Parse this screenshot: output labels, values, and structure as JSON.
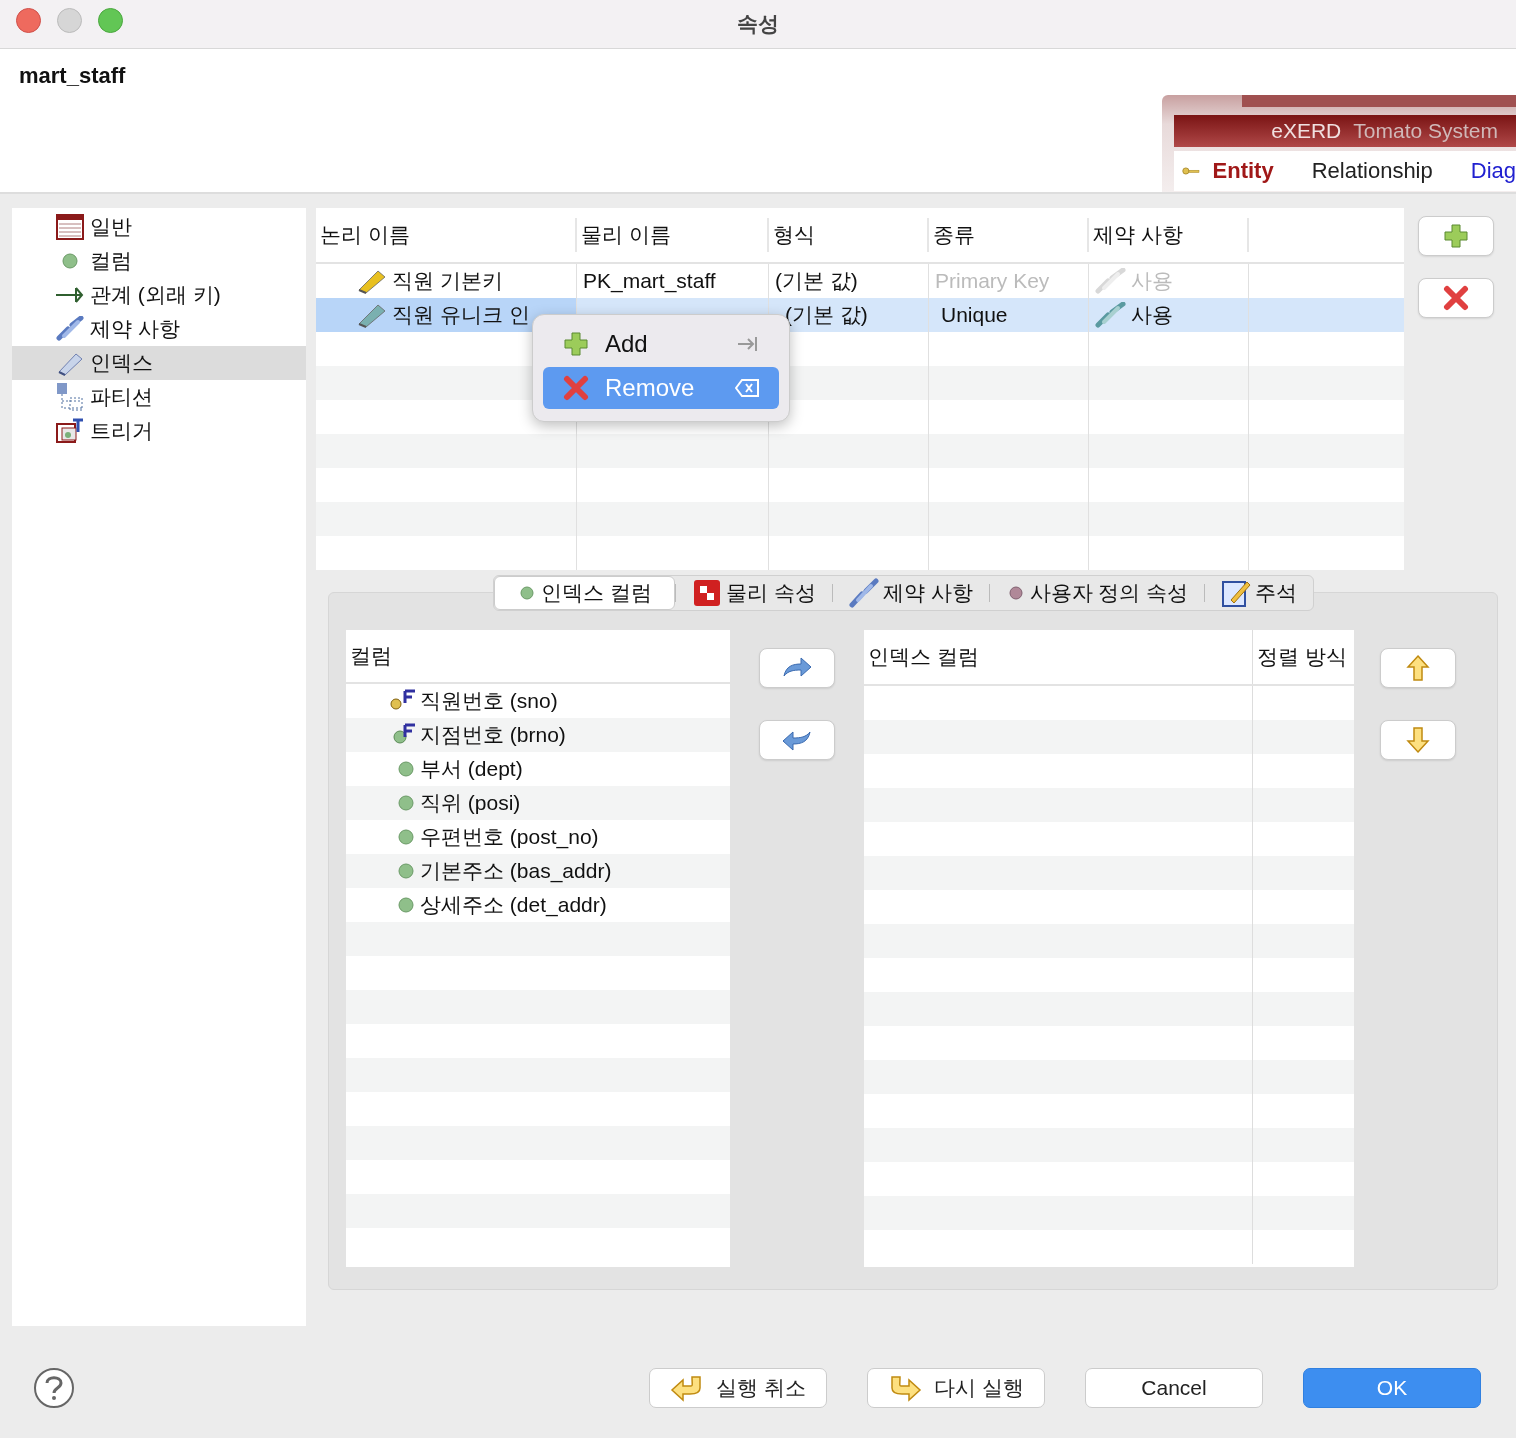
{
  "window": {
    "title": "속성"
  },
  "header": {
    "entity_name": "mart_staff",
    "banner": {
      "title": "eXERD",
      "subtitle": "Tomato System",
      "tabs": [
        {
          "label": "Entity",
          "selected": true
        },
        {
          "label": "Relationship",
          "selected": false
        },
        {
          "label": "Diag",
          "selected": false
        }
      ]
    }
  },
  "sidebar": {
    "items": [
      {
        "label": "일반",
        "kind": "general",
        "selected": false
      },
      {
        "label": "컬럼",
        "kind": "column",
        "selected": false
      },
      {
        "label": "관계 (외래 키)",
        "kind": "relation",
        "selected": false
      },
      {
        "label": "제약 사항",
        "kind": "constraint",
        "selected": false
      },
      {
        "label": "인덱스",
        "kind": "index",
        "selected": true
      },
      {
        "label": "파티션",
        "kind": "partition",
        "selected": false
      },
      {
        "label": "트리거",
        "kind": "trigger",
        "selected": false
      }
    ]
  },
  "index_table": {
    "columns": [
      "논리 이름",
      "물리 이름",
      "형식",
      "종류",
      "제약 사항"
    ],
    "rows": [
      {
        "logical_name": "직원 기본키",
        "physical_name": "PK_mart_staff",
        "format": "(기본 값)",
        "type": "Primary Key",
        "constraint": "사용",
        "selected": false,
        "disabled": true,
        "color": "#e8c020"
      },
      {
        "logical_name": "직원 유니크 인",
        "format": "(기본 값)",
        "type": "Unique",
        "constraint": "사용",
        "selected": true,
        "disabled": false,
        "color": "#7ab0b0"
      }
    ]
  },
  "context_menu": {
    "items": [
      {
        "label": "Add",
        "kind": "add",
        "selected": false
      },
      {
        "label": "Remove",
        "kind": "remove",
        "selected": true
      }
    ]
  },
  "detail_tabs": [
    {
      "label": "인덱스 컬럼",
      "kind": "dot",
      "selected": true
    },
    {
      "label": "물리 속성",
      "kind": "checker",
      "selected": false
    },
    {
      "label": "제약 사항",
      "kind": "chain",
      "selected": false
    },
    {
      "label": "사용자 정의 속성",
      "kind": "dot2",
      "selected": false
    },
    {
      "label": "주석",
      "kind": "note",
      "selected": false
    }
  ],
  "available_columns": {
    "header": "컬럼",
    "items": [
      {
        "label": "직원번호 (sno)",
        "kind": "pk-fk"
      },
      {
        "label": "지점번호 (brno)",
        "kind": "fk"
      },
      {
        "label": "부서 (dept)",
        "kind": "column"
      },
      {
        "label": "직위 (posi)",
        "kind": "column"
      },
      {
        "label": "우편번호 (post_no)",
        "kind": "column"
      },
      {
        "label": "기본주소 (bas_addr)",
        "kind": "column"
      },
      {
        "label": "상세주소 (det_addr)",
        "kind": "column"
      }
    ]
  },
  "index_columns": {
    "columns": [
      "인덱스 컬럼",
      "정렬 방식"
    ]
  },
  "footer": {
    "buttons": [
      {
        "label": "실행 취소",
        "kind": "undo"
      },
      {
        "label": "다시 실행",
        "kind": "redo"
      },
      {
        "label": "Cancel",
        "kind": "plain"
      },
      {
        "label": "OK",
        "kind": "default"
      }
    ]
  }
}
